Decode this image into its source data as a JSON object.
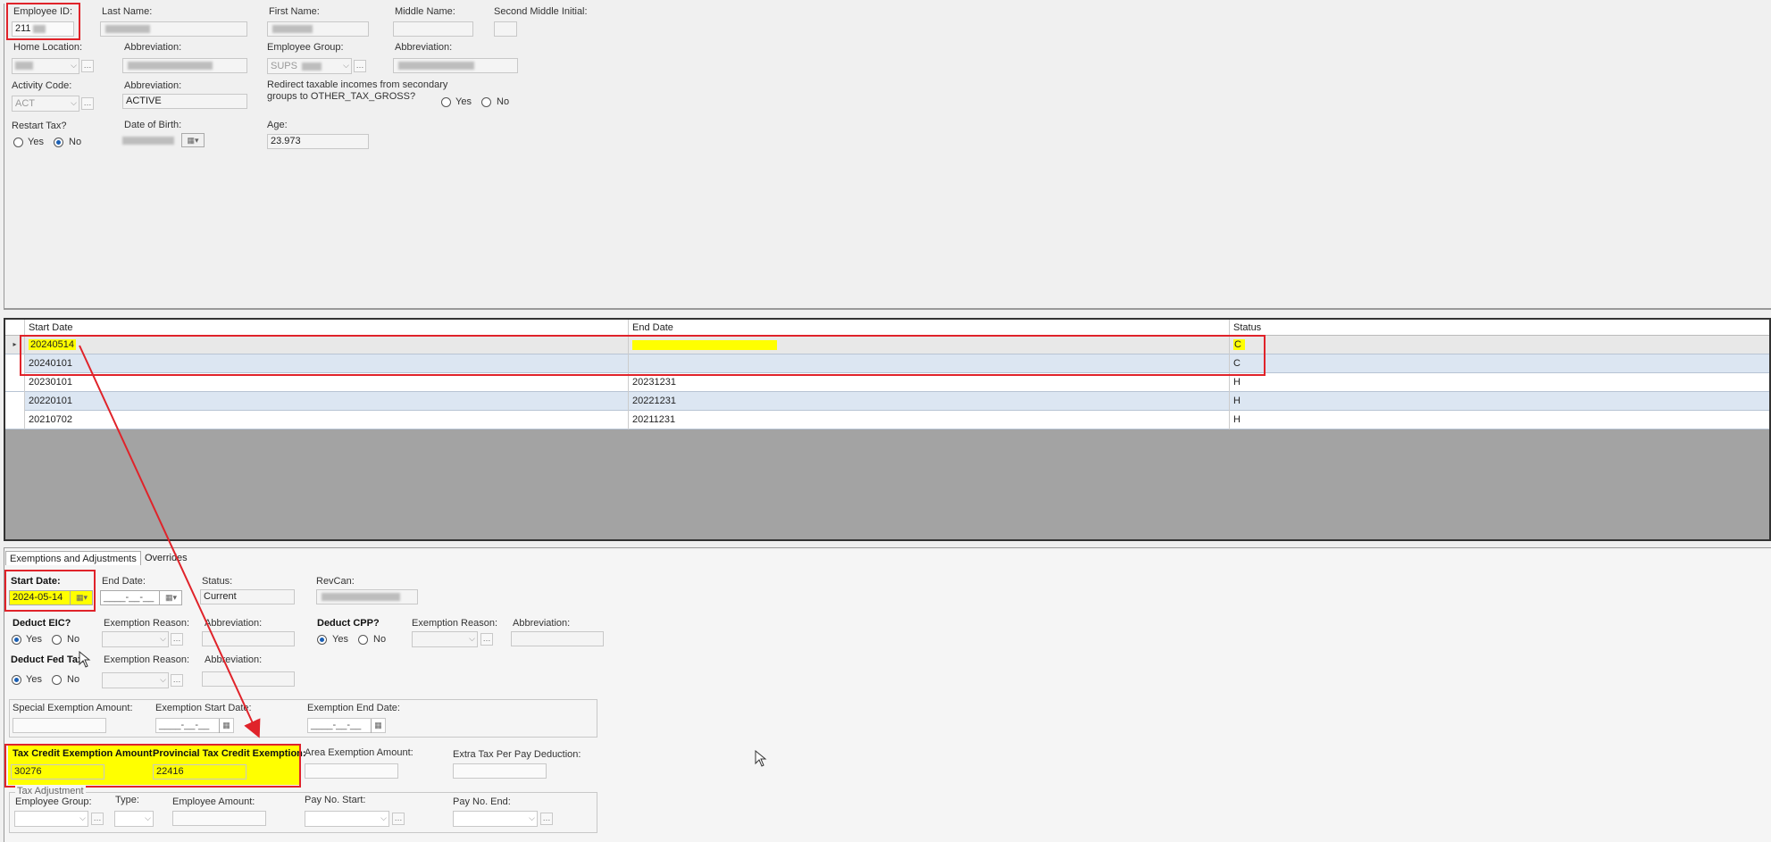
{
  "header": {
    "employee_id_label": "Employee ID:",
    "employee_id_value": "211",
    "last_name_label": "Last Name:",
    "first_name_label": "First Name:",
    "middle_name_label": "Middle Name:",
    "second_middle_initial_label": "Second Middle Initial:",
    "home_location_label": "Home Location:",
    "abbreviation_label": "Abbreviation:",
    "employee_group_label": "Employee Group:",
    "employee_group_value": "SUPS",
    "activity_code_label": "Activity Code:",
    "activity_code_value": "ACT",
    "activity_abbrev_value": "ACTIVE",
    "redirect_label_line1": "Redirect taxable incomes from secondary",
    "redirect_label_line2": "groups to OTHER_TAX_GROSS?",
    "yes_label": "Yes",
    "no_label": "No",
    "restart_tax_label": "Restart Tax?",
    "date_of_birth_label": "Date of Birth:",
    "age_label": "Age:",
    "age_value": "23.973",
    "restart_tax_selected": "No"
  },
  "grid": {
    "columns": [
      "Start Date",
      "End Date",
      "Status"
    ],
    "rows": [
      {
        "start": "20240514",
        "end": "",
        "status": "C"
      },
      {
        "start": "20240101",
        "end": "",
        "status": "C"
      },
      {
        "start": "20230101",
        "end": "20231231",
        "status": "H"
      },
      {
        "start": "20220101",
        "end": "20221231",
        "status": "H"
      },
      {
        "start": "20210702",
        "end": "20211231",
        "status": "H"
      }
    ]
  },
  "tabs": {
    "exemptions": "Exemptions and Adjustments",
    "overrides": "Overrides"
  },
  "detail": {
    "start_date_label": "Start Date:",
    "start_date_value": "2024-05-14",
    "end_date_label": "End Date:",
    "end_date_placeholder": "____-__-__",
    "status_label": "Status:",
    "status_value": "Current",
    "revcan_label": "RevCan:",
    "deduct_eic_label": "Deduct EIC?",
    "exemption_reason_label": "Exemption Reason:",
    "abbreviation_label": "Abbreviation:",
    "deduct_cpp_label": "Deduct CPP?",
    "deduct_fed_tax_label": "Deduct Fed Tax",
    "yes_label": "Yes",
    "no_label": "No",
    "special_exemption_label": "Special Exemption Amount:",
    "exemption_start_label": "Exemption Start Date:",
    "exemption_end_label": "Exemption End Date:",
    "date_placeholder": "____-__-__",
    "tax_credit_label": "Tax Credit Exemption Amount:",
    "tax_credit_value": "30276",
    "provincial_label": "Provincial Tax Credit Exemption:",
    "provincial_value": "22416",
    "area_exemption_label": "Area Exemption Amount:",
    "extra_tax_label": "Extra Tax Per Pay Deduction:",
    "tax_adjustment_label": "Tax Adjustment",
    "employee_group_label": "Employee Group:",
    "type_label": "Type:",
    "employee_amount_label": "Employee Amount:",
    "pay_no_start_label": "Pay No. Start:",
    "pay_no_end_label": "Pay No. End:"
  },
  "colors": {
    "highlight": "#ffff00",
    "annotation_red": "#e0232a",
    "row_alt": "#dce6f2"
  }
}
